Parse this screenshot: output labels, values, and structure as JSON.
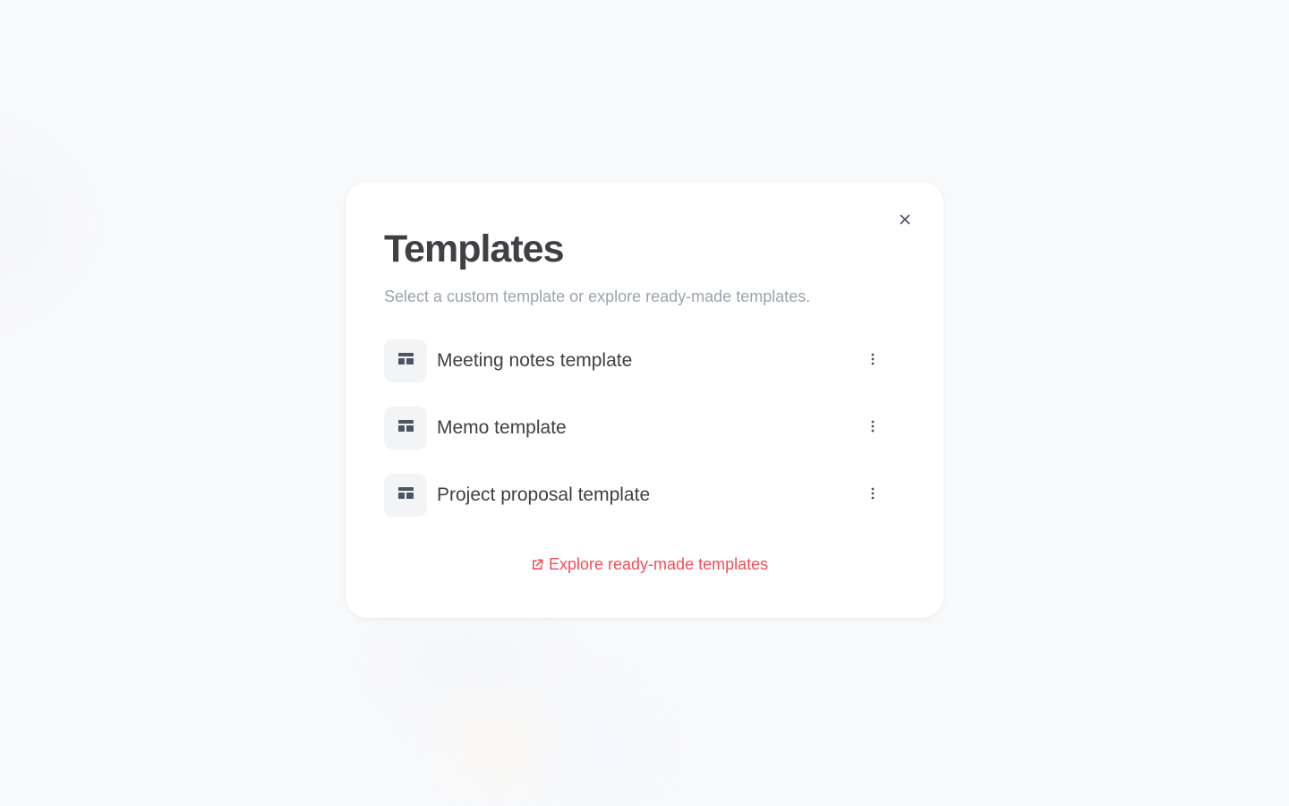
{
  "colors": {
    "background": "#f9fafb",
    "modal_background": "#ffffff",
    "title_text": "#3f4044",
    "muted_text": "#9ca3af",
    "icon_background": "#f3f4f6",
    "icon": "#4b5563",
    "link_accent": "#ef4e5a"
  },
  "modal": {
    "title": "Templates",
    "subtitle": "Select a custom template or explore ready-made templates.",
    "close_icon": "close-icon",
    "templates": [
      {
        "label": "Meeting notes template",
        "icon": "template-layout-icon",
        "menu_icon": "more-vertical-icon"
      },
      {
        "label": "Memo template",
        "icon": "template-layout-icon",
        "menu_icon": "more-vertical-icon"
      },
      {
        "label": "Project proposal template",
        "icon": "template-layout-icon",
        "menu_icon": "more-vertical-icon"
      }
    ],
    "explore_link": {
      "label": "Explore ready-made templates",
      "icon": "external-link-icon"
    }
  }
}
